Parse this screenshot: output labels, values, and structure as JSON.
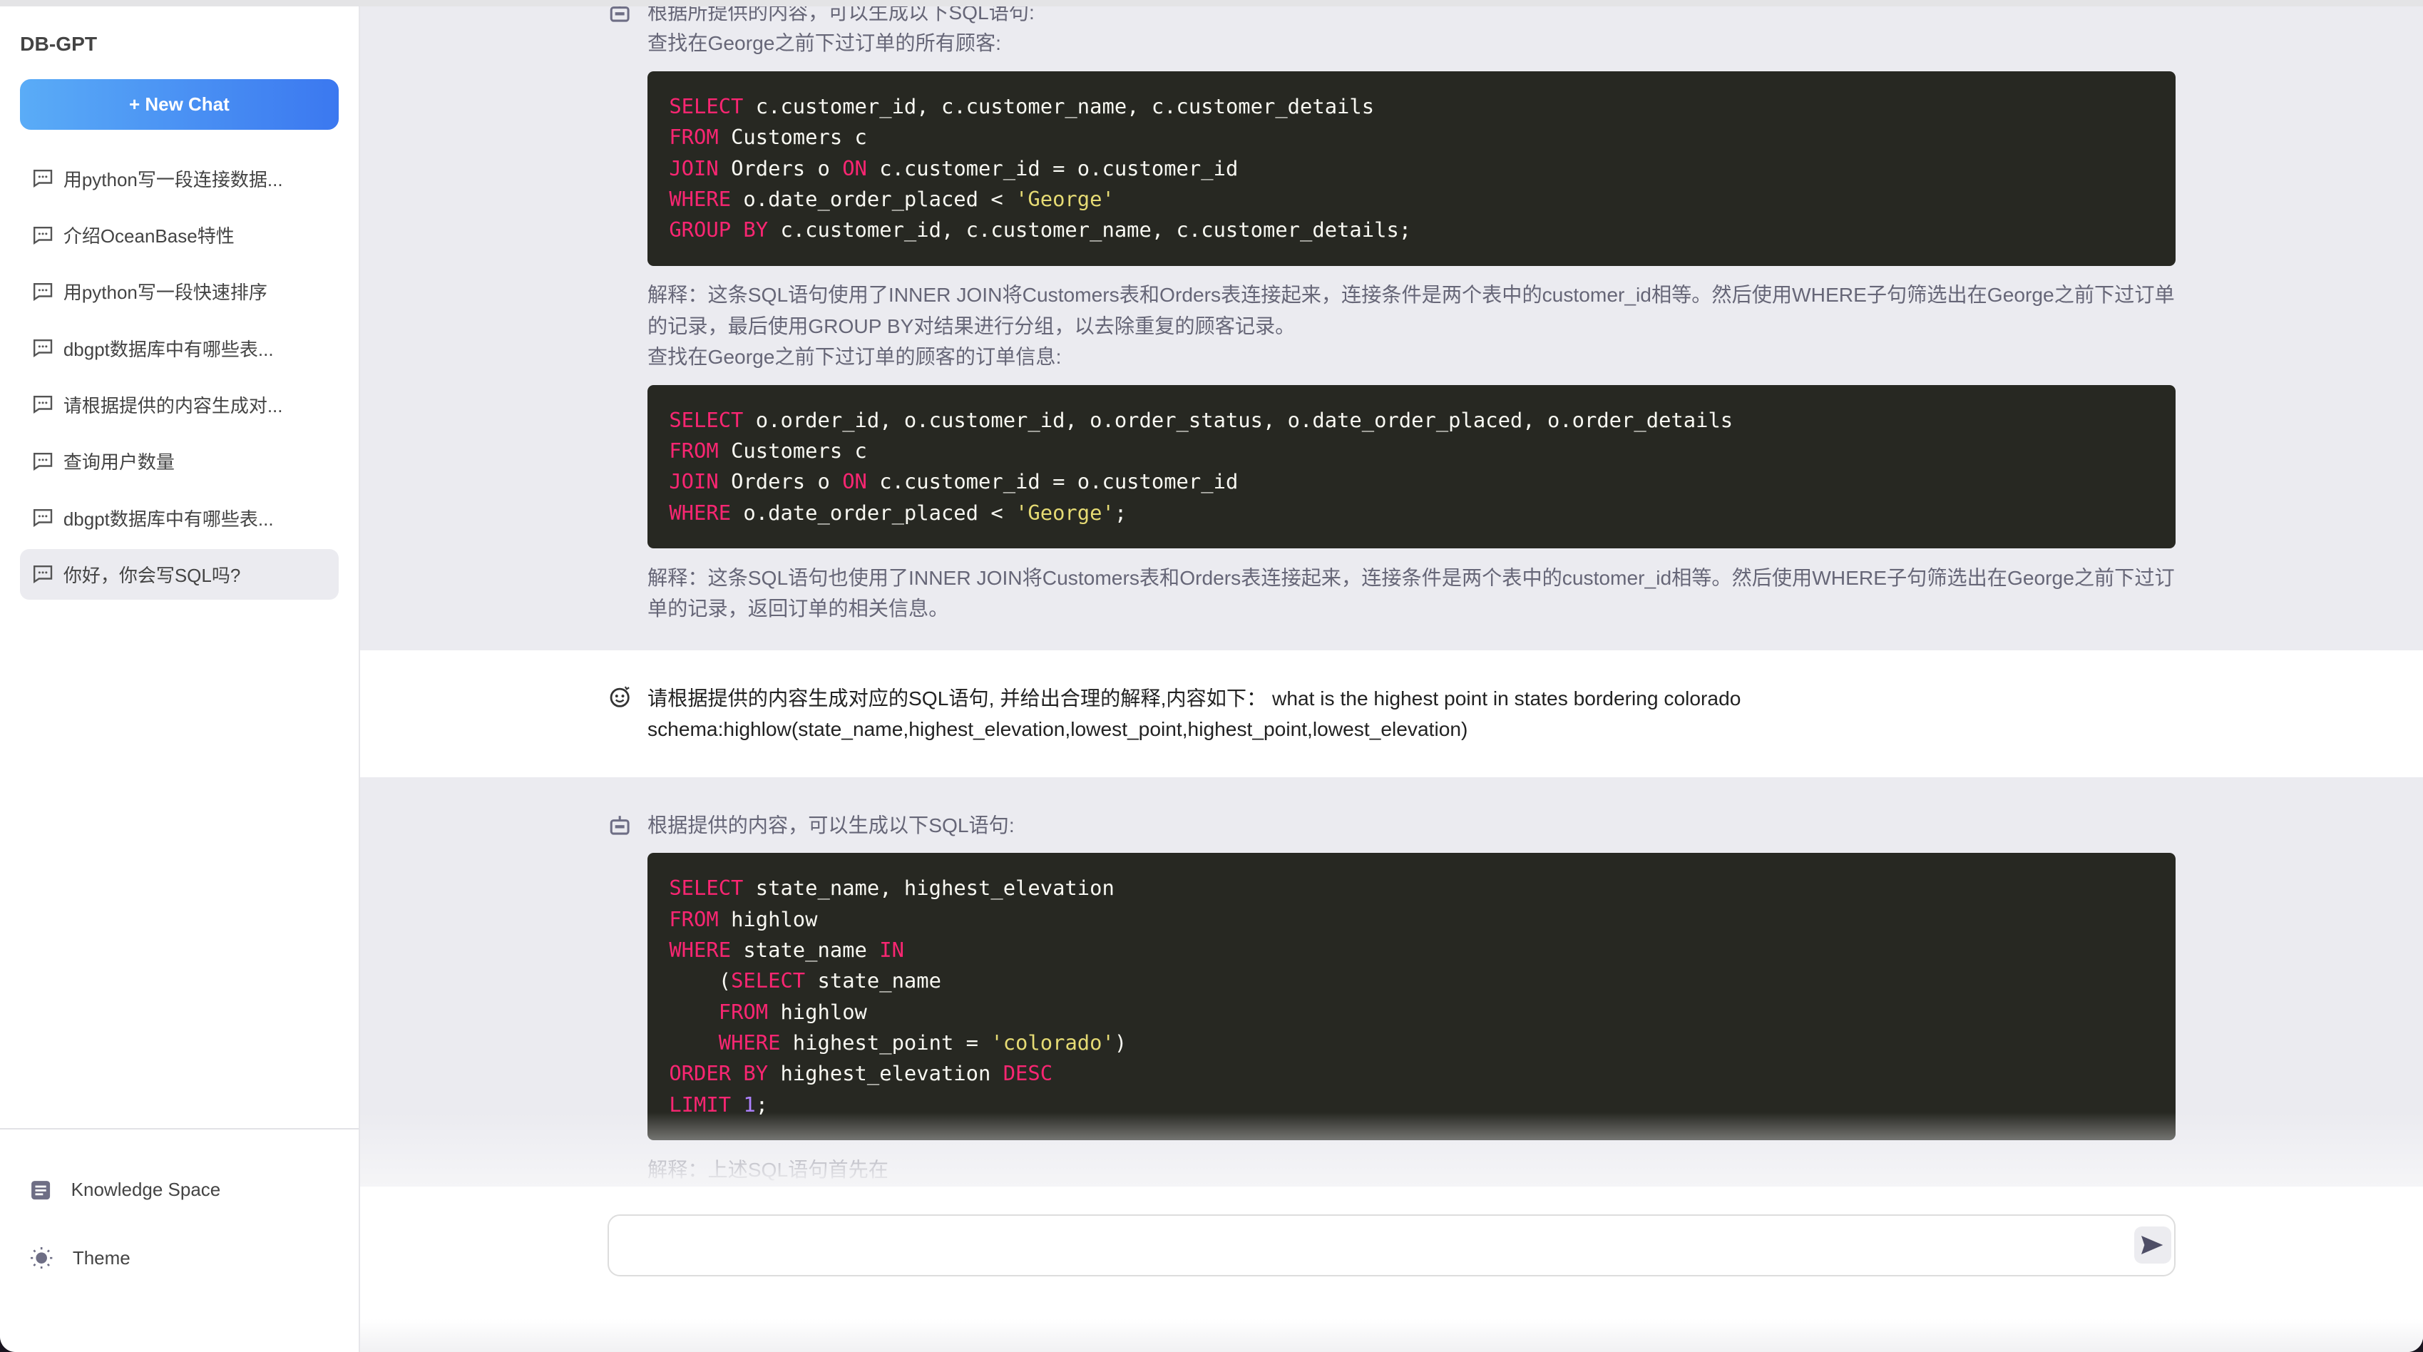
{
  "app": {
    "title": "DB-GPT"
  },
  "sidebar": {
    "new_chat_label": "+ New Chat",
    "history": [
      {
        "label": "用python写一段连接数据..."
      },
      {
        "label": "介绍OceanBase特性"
      },
      {
        "label": "用python写一段快速排序"
      },
      {
        "label": "dbgpt数据库中有哪些表..."
      },
      {
        "label": "请根据提供的内容生成对..."
      },
      {
        "label": "查询用户数量"
      },
      {
        "label": "dbgpt数据库中有哪些表..."
      },
      {
        "label": "你好，你会写SQL吗?",
        "active": true
      }
    ],
    "knowledge_space_label": "Knowledge Space",
    "theme_label": "Theme"
  },
  "colors": {
    "accent_start": "#5aacf7",
    "accent_end": "#3b78f0",
    "code_bg": "#272822",
    "keyword": "#f92672",
    "string": "#e6db74",
    "number": "#ae81ff"
  },
  "messages": [
    {
      "role": "bot",
      "intro": "根据所提供的内容，可以生成以下SQL语句:",
      "q1": "查找在George之前下过订单的所有顾客:",
      "code1": [
        [
          [
            "kw",
            "SELECT"
          ],
          [
            "t",
            " c.customer_id, c.customer_name, c.customer_details"
          ]
        ],
        [
          [
            "kw",
            "FROM"
          ],
          [
            "t",
            " Customers c"
          ]
        ],
        [
          [
            "kw",
            "JOIN"
          ],
          [
            "t",
            " Orders o "
          ],
          [
            "kw",
            "ON"
          ],
          [
            "t",
            " c.customer_id = o.customer_id"
          ]
        ],
        [
          [
            "kw",
            "WHERE"
          ],
          [
            "t",
            " o.date_order_placed < "
          ],
          [
            "str",
            "'George'"
          ]
        ],
        [
          [
            "kw",
            "GROUP BY"
          ],
          [
            "t",
            " c.customer_id, c.customer_name, c.customer_details;"
          ]
        ]
      ],
      "exp1": "解释：这条SQL语句使用了INNER JOIN将Customers表和Orders表连接起来，连接条件是两个表中的customer_id相等。然后使用WHERE子句筛选出在George之前下过订单的记录，最后使用GROUP BY对结果进行分组，以去除重复的顾客记录。",
      "q2": "查找在George之前下过订单的顾客的订单信息:",
      "code2": [
        [
          [
            "kw",
            "SELECT"
          ],
          [
            "t",
            " o.order_id, o.customer_id, o.order_status, o.date_order_placed, o.order_details"
          ]
        ],
        [
          [
            "kw",
            "FROM"
          ],
          [
            "t",
            " Customers c"
          ]
        ],
        [
          [
            "kw",
            "JOIN"
          ],
          [
            "t",
            " Orders o "
          ],
          [
            "kw",
            "ON"
          ],
          [
            "t",
            " c.customer_id = o.customer_id"
          ]
        ],
        [
          [
            "kw",
            "WHERE"
          ],
          [
            "t",
            " o.date_order_placed < "
          ],
          [
            "str",
            "'George'"
          ],
          [
            "t",
            ";"
          ]
        ]
      ],
      "exp2": "解释：这条SQL语句也使用了INNER JOIN将Customers表和Orders表连接起来，连接条件是两个表中的customer_id相等。然后使用WHERE子句筛选出在George之前下过订单的记录，返回订单的相关信息。"
    },
    {
      "role": "user",
      "line1": "请根据提供的内容生成对应的SQL语句, 并给出合理的解释,内容如下： what is the highest point in states bordering colorado",
      "line2": "schema:highlow(state_name,highest_elevation,lowest_point,highest_point,lowest_elevation)"
    },
    {
      "role": "bot",
      "intro": "根据提供的内容，可以生成以下SQL语句:",
      "code1": [
        [
          [
            "kw",
            "SELECT"
          ],
          [
            "t",
            " state_name, highest_elevation"
          ]
        ],
        [
          [
            "kw",
            "FROM"
          ],
          [
            "t",
            " highlow"
          ]
        ],
        [
          [
            "kw",
            "WHERE"
          ],
          [
            "t",
            " state_name "
          ],
          [
            "kw",
            "IN"
          ]
        ],
        [
          [
            "t",
            "    ("
          ],
          [
            "kw",
            "SELECT"
          ],
          [
            "t",
            " state_name"
          ]
        ],
        [
          [
            "t",
            "    "
          ],
          [
            "kw",
            "FROM"
          ],
          [
            "t",
            " highlow"
          ]
        ],
        [
          [
            "t",
            "    "
          ],
          [
            "kw",
            "WHERE"
          ],
          [
            "t",
            " highest_point = "
          ],
          [
            "str",
            "'colorado'"
          ],
          [
            "t",
            ")"
          ]
        ],
        [
          [
            "kw",
            "ORDER BY"
          ],
          [
            "t",
            " highest_elevation "
          ],
          [
            "kw",
            "DESC"
          ]
        ],
        [
          [
            "kw",
            "LIMIT"
          ],
          [
            "t",
            " "
          ],
          [
            "num",
            "1"
          ],
          [
            "t",
            ";"
          ]
        ]
      ],
      "exp1": "解释：上述SQL语句首先在"
    }
  ],
  "input": {
    "value": "",
    "placeholder": ""
  },
  "icons": {
    "history": "message-icon",
    "bot": "robot-icon",
    "user": "smile-icon",
    "knowledge": "document-icon",
    "theme": "sun-icon",
    "send": "send-icon"
  }
}
